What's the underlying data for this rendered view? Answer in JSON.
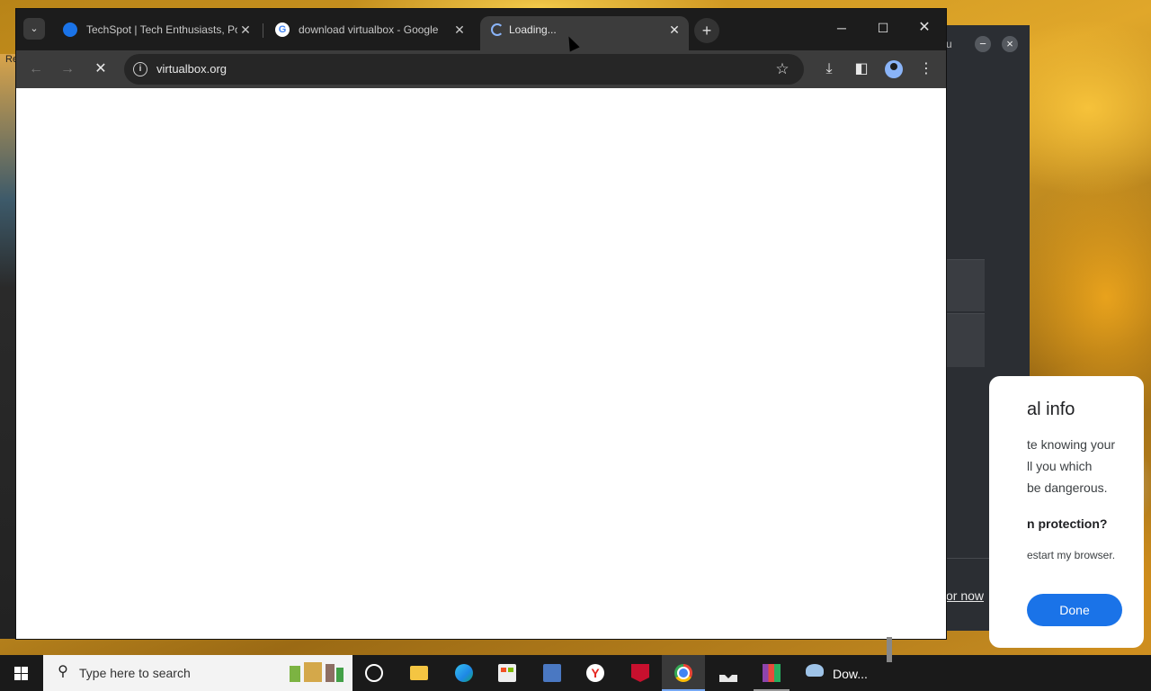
{
  "desktop": {
    "left_label": "Re"
  },
  "background_window": {
    "title_fragment": "u",
    "link_fragment": "or now"
  },
  "side_dialog": {
    "heading_fragment": "al info",
    "line1": "te knowing your",
    "line2": "ll you which",
    "line3": "be dangerous.",
    "question_fragment": "n protection?",
    "small_text": "estart my browser.",
    "done_label": "Done"
  },
  "browser": {
    "tabs": [
      {
        "title": "TechSpot | Tech Enthusiasts, Po",
        "favicon": "techspot-icon",
        "active": false
      },
      {
        "title": "download virtualbox - Google",
        "favicon": "google-icon",
        "active": false
      },
      {
        "title": "Loading...",
        "favicon": "loading-spinner-icon",
        "active": true
      }
    ],
    "google_letter": "G",
    "yandex_letter": "Y",
    "tab_close_glyph": "✕",
    "new_tab_glyph": "+",
    "address": "virtualbox.org",
    "window_controls": {
      "minimize": "─",
      "maximize": "☐",
      "close": "✕"
    },
    "toolbar_glyphs": {
      "back": "←",
      "forward": "→",
      "stop": "✕",
      "info": "i",
      "star": "☆",
      "download": "⤓",
      "side_panel": "◧",
      "menu": "⋮",
      "tab_search": "⌄"
    }
  },
  "taskbar": {
    "search_placeholder": "Type here to search",
    "search_glyph": "⚲",
    "weather_label": "Dow..."
  },
  "colors": {
    "accent_blue": "#1a73e8",
    "tabstrip_bg": "#1c1c1c",
    "toolbar_bg": "#3c3c3c",
    "omnibox_bg": "#262626"
  }
}
